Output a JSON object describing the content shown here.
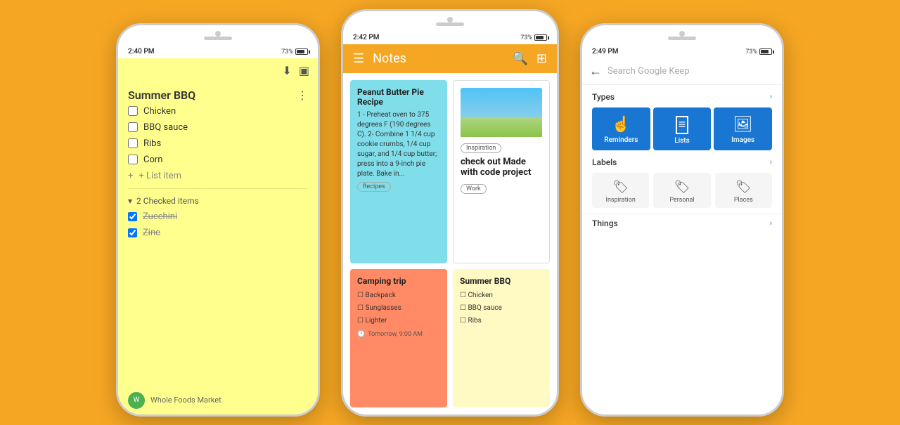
{
  "background": "#F5A623",
  "phones": {
    "left": {
      "status": {
        "time": "2:40 PM",
        "battery": "73%"
      },
      "note": {
        "title": "Summer BBQ",
        "items": [
          {
            "label": "Chicken",
            "checked": false
          },
          {
            "label": "BBQ sauce",
            "checked": false
          },
          {
            "label": "Ribs",
            "checked": false
          },
          {
            "label": "Corn",
            "checked": false
          }
        ],
        "add_item_label": "+ List item",
        "checked_section_label": "2 Checked items",
        "checked_items": [
          {
            "label": "Zucchini",
            "checked": true
          },
          {
            "label": "Zinc",
            "checked": true
          }
        ],
        "footer_text": "Whole Foods Market"
      }
    },
    "center": {
      "status": {
        "time": "2:42 PM",
        "battery": "73%"
      },
      "appbar": {
        "title": "Notes",
        "menu_icon": "☰",
        "search_icon": "🔍",
        "grid_icon": "⊞"
      },
      "cards": [
        {
          "type": "text",
          "color": "cyan",
          "title": "Peanut Butter Pie Recipe",
          "text": "1 - Preheat oven to 375 degrees F (190 degrees C).\n2- Combine 1 1/4 cup cookie crumbs, 1/4 cup sugar, and 1/4 cup butter; press into a 9-inch pie plate. Bake in...",
          "tag": "Recipes"
        },
        {
          "type": "image",
          "title": "Inspiration",
          "subtext": "check out Made with code project",
          "tag": "Work"
        },
        {
          "type": "checklist",
          "color": "orange",
          "title": "Camping trip",
          "items": [
            "Backpack",
            "Sunglasses",
            "Lighter"
          ],
          "time": "Tomorrow, 9:00 AM"
        },
        {
          "type": "checklist",
          "color": "yellow",
          "title": "Summer BBQ",
          "items": [
            "Chicken",
            "BBQ sauce",
            "Ribs"
          ]
        }
      ]
    },
    "right": {
      "status": {
        "time": "2:49 PM",
        "battery": "73%"
      },
      "search": {
        "placeholder": "Search Google Keep",
        "types_title": "Types",
        "types_more": "h",
        "types": [
          {
            "icon": "👆",
            "label": "Reminders"
          },
          {
            "icon": "≡",
            "label": "Lists"
          },
          {
            "icon": "🖼",
            "label": "Images"
          }
        ],
        "labels_title": "Labels",
        "labels_more": "h",
        "labels": [
          {
            "name": "Inspiration"
          },
          {
            "name": "Personal"
          },
          {
            "name": "Places"
          }
        ],
        "things_title": "Things",
        "things_more": "h"
      }
    }
  }
}
